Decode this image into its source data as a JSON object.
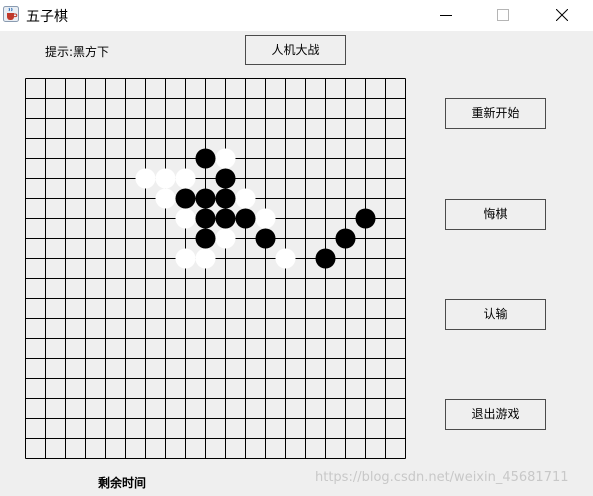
{
  "window": {
    "title": "五子棋",
    "icon": "java-cup-icon"
  },
  "status": {
    "hint": "提示:黑方下",
    "timer_label": "剩余时间"
  },
  "buttons": {
    "mode": "人机大战",
    "restart": "重新开始",
    "undo": "悔棋",
    "resign": "认输",
    "exit": "退出游戏"
  },
  "board": {
    "size": 19,
    "stones": [
      {
        "color": "black",
        "col": 9,
        "row": 4
      },
      {
        "color": "white",
        "col": 10,
        "row": 4
      },
      {
        "color": "white",
        "col": 6,
        "row": 5
      },
      {
        "color": "white",
        "col": 7,
        "row": 5
      },
      {
        "color": "white",
        "col": 8,
        "row": 5
      },
      {
        "color": "black",
        "col": 10,
        "row": 5
      },
      {
        "color": "white",
        "col": 7,
        "row": 6
      },
      {
        "color": "black",
        "col": 8,
        "row": 6
      },
      {
        "color": "black",
        "col": 9,
        "row": 6
      },
      {
        "color": "black",
        "col": 10,
        "row": 6
      },
      {
        "color": "white",
        "col": 11,
        "row": 6
      },
      {
        "color": "white",
        "col": 8,
        "row": 7
      },
      {
        "color": "black",
        "col": 9,
        "row": 7
      },
      {
        "color": "black",
        "col": 10,
        "row": 7
      },
      {
        "color": "black",
        "col": 11,
        "row": 7
      },
      {
        "color": "white",
        "col": 12,
        "row": 7
      },
      {
        "color": "black",
        "col": 17,
        "row": 7
      },
      {
        "color": "black",
        "col": 9,
        "row": 8
      },
      {
        "color": "white",
        "col": 10,
        "row": 8
      },
      {
        "color": "black",
        "col": 12,
        "row": 8
      },
      {
        "color": "black",
        "col": 16,
        "row": 8
      },
      {
        "color": "white",
        "col": 8,
        "row": 9
      },
      {
        "color": "white",
        "col": 9,
        "row": 9
      },
      {
        "color": "white",
        "col": 13,
        "row": 9
      },
      {
        "color": "black",
        "col": 15,
        "row": 9
      }
    ]
  },
  "watermark": "https://blog.csdn.net/weixin_45681711"
}
